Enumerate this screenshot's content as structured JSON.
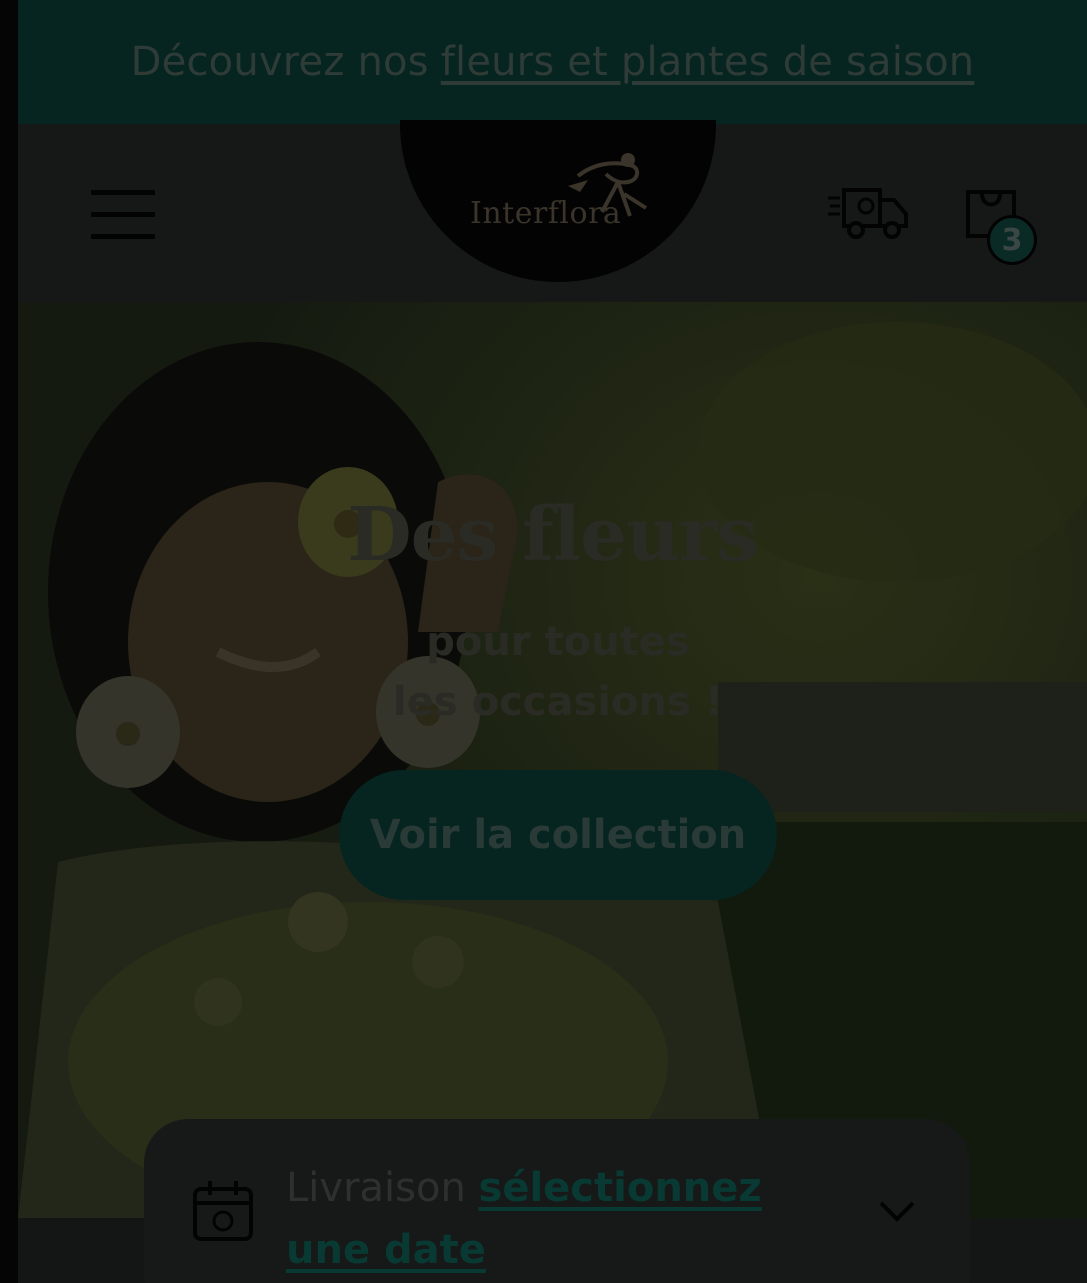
{
  "promo": {
    "text": "Découvrez nos",
    "link": "fleurs et plantes de saison"
  },
  "header": {
    "logo_text": "Interflora",
    "cart_count": "3",
    "icons": [
      "menu-icon",
      "delivery-truck-icon",
      "shopping-bag-icon"
    ]
  },
  "hero": {
    "title": "Des fleurs",
    "subtitle": "pour toutes les occasions !",
    "cta_label": "Voir la collection"
  },
  "delivery": {
    "label": "Livraison",
    "link": "sélectionnez une date",
    "icons": [
      "calendar-icon",
      "chevron-down-icon"
    ]
  },
  "colors": {
    "brand_dark": "#062420",
    "overlay": "#0a0c0b"
  }
}
